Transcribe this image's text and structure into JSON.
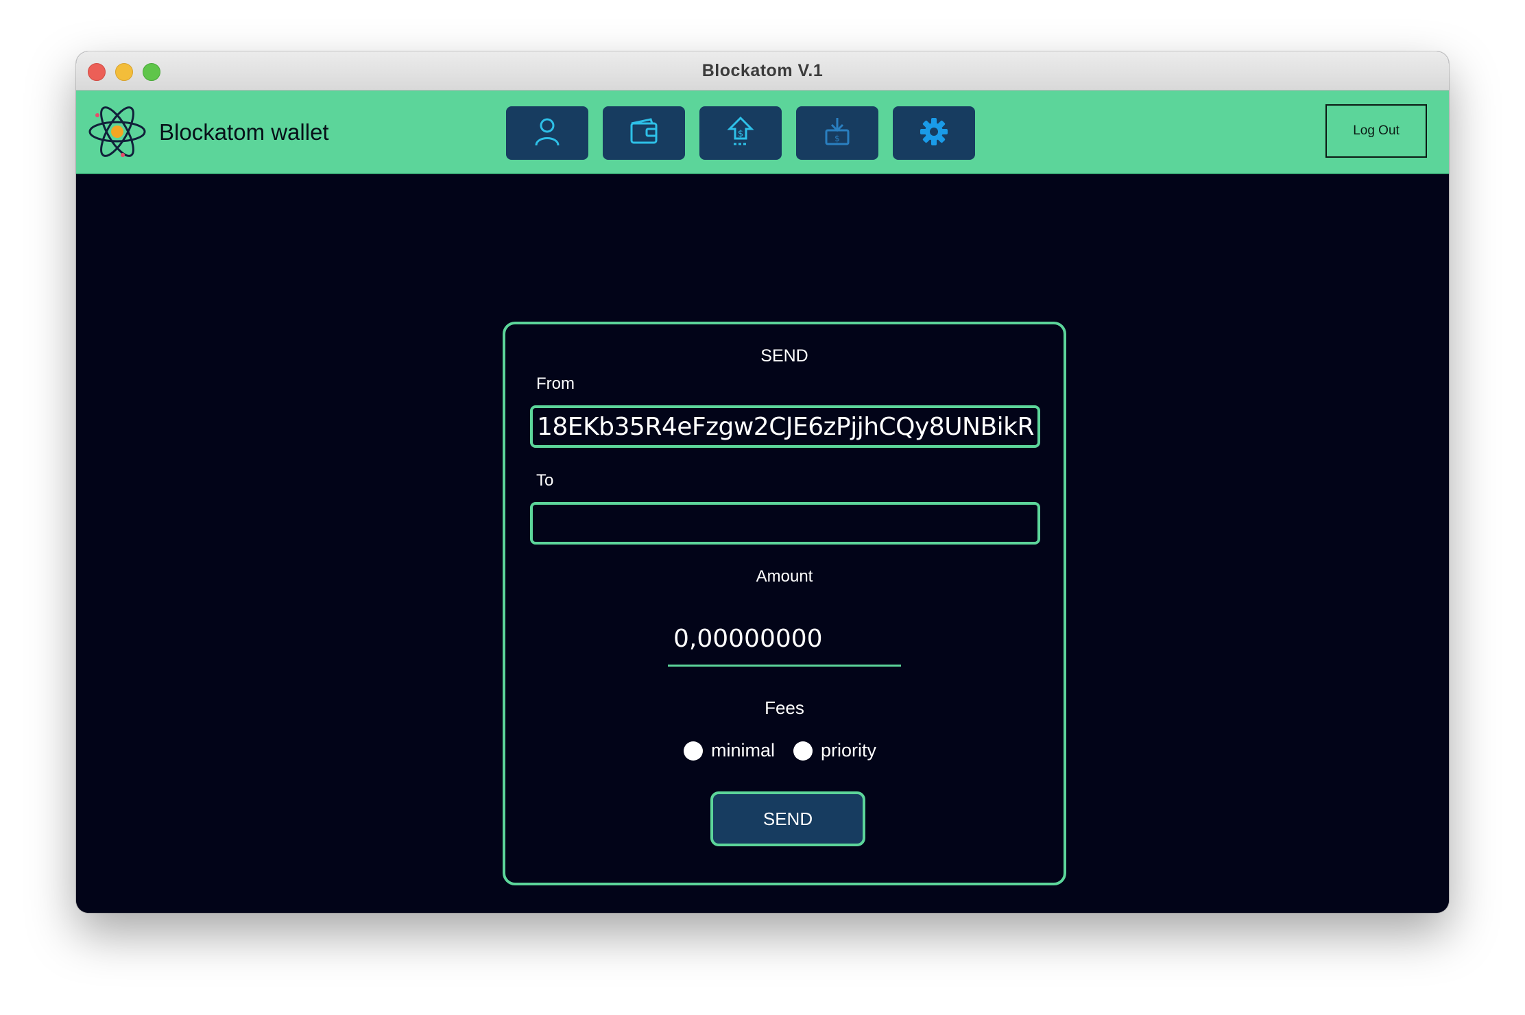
{
  "window": {
    "title": "Blockatom V.1"
  },
  "toolbar": {
    "brand_name": "Blockatom wallet",
    "nav": [
      {
        "icon": "user-icon"
      },
      {
        "icon": "wallet-icon"
      },
      {
        "icon": "send-money-icon"
      },
      {
        "icon": "receive-money-icon"
      },
      {
        "icon": "gear-icon"
      }
    ],
    "logout_label": "Log Out"
  },
  "send_form": {
    "title": "SEND",
    "from_label": "From",
    "from_value": "18EKb35R4eFzgw2CJE6zPjjhCQy8UNBikR",
    "to_label": "To",
    "to_value": "",
    "amount_label": "Amount",
    "amount_value": "0,00000000",
    "fees_label": "Fees",
    "fee_options": [
      "minimal",
      "priority"
    ],
    "submit_label": "SEND"
  },
  "colors": {
    "accent": "#5cd59a",
    "button": "#173c60",
    "background": "#020418"
  }
}
